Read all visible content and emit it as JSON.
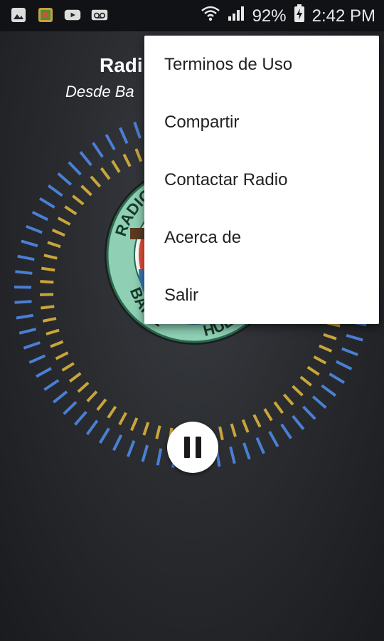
{
  "status_bar": {
    "left_icons": [
      "gallery-icon",
      "photo-app-icon",
      "youtube-icon",
      "voicemail-icon"
    ],
    "battery_percent": "92%",
    "time": "2:42 PM"
  },
  "header": {
    "title": "Radi",
    "subtitle": "Desde Ba"
  },
  "logo": {
    "text_top": "RADIO “S",
    "text_bottom": "BARIL",
    "text_bottom_right": "HUEHUE"
  },
  "menu": {
    "items": [
      {
        "label": "Terminos de Uso"
      },
      {
        "label": "Compartir"
      },
      {
        "label": "Contactar Radio"
      },
      {
        "label": "Acerca de"
      },
      {
        "label": "Salir"
      }
    ]
  },
  "colors": {
    "bar_blue": "#4a7fd4",
    "bar_yellow": "#c9a63a",
    "background": "#2a2c30"
  }
}
